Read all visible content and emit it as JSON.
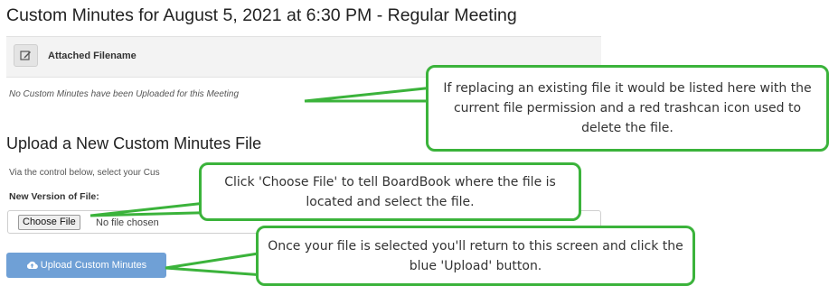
{
  "page_title": "Custom Minutes for August 5, 2021 at 6:30 PM - Regular Meeting",
  "attachments": {
    "column_header": "Attached Filename",
    "empty_message": "No Custom Minutes have been Uploaded for this Meeting"
  },
  "upload": {
    "section_title": "Upload a New Custom Minutes File",
    "instructions": "Via the control below, select your Cus",
    "file_label": "New Version of File:",
    "choose_button": "Choose File",
    "no_file_text": "No file chosen",
    "submit_label": "Upload Custom Minutes"
  },
  "callouts": {
    "replace_note": "If replacing an existing file it would be listed here with the current file permission and a red trashcan icon used to delete the file.",
    "choose_note": "Click 'Choose File' to tell BoardBook where the file is located and select the file.",
    "upload_note": "Once your file is selected you'll return to this screen and click the blue 'Upload' button."
  },
  "colors": {
    "callout_border": "#3bb33b",
    "upload_button": "#6fa0d6"
  },
  "icons": {
    "edit": "edit-icon",
    "upload": "cloud-upload-icon"
  }
}
